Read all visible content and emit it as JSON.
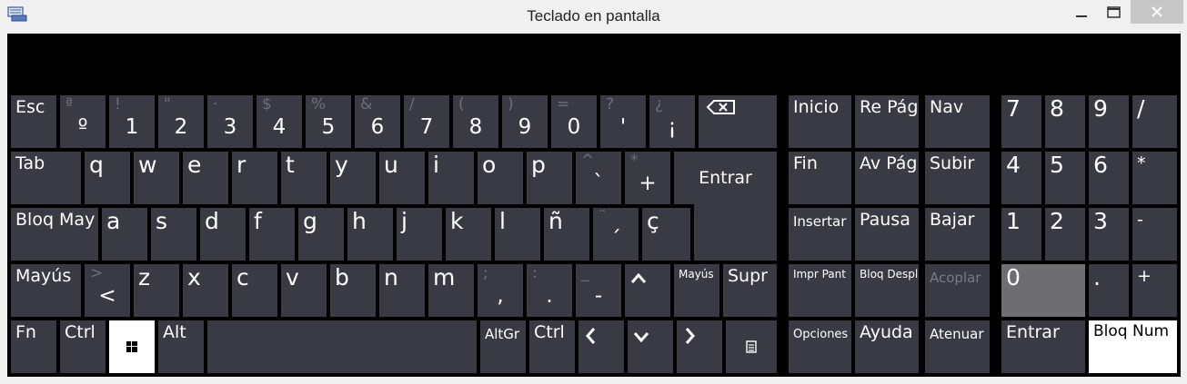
{
  "window": {
    "title": "Teclado en pantalla"
  },
  "row1": {
    "esc": "Esc",
    "k1": {
      "shift": "ª",
      "base": "º"
    },
    "k2": {
      "shift": "!",
      "base": "1"
    },
    "k3": {
      "shift": "\"",
      "base": "2"
    },
    "k4": {
      "shift": "·",
      "base": "3"
    },
    "k5": {
      "shift": "$",
      "base": "4"
    },
    "k6": {
      "shift": "%",
      "base": "5"
    },
    "k7": {
      "shift": "&",
      "base": "6"
    },
    "k8": {
      "shift": "/",
      "base": "7"
    },
    "k9": {
      "shift": "(",
      "base": "8"
    },
    "k10": {
      "shift": ")",
      "base": "9"
    },
    "k11": {
      "shift": "=",
      "base": "0"
    },
    "k12": {
      "shift": "?",
      "base": "'"
    },
    "k13": {
      "shift": "¿",
      "base": "¡"
    }
  },
  "row2": {
    "tab": "Tab",
    "letters": [
      "q",
      "w",
      "e",
      "r",
      "t",
      "y",
      "u",
      "i",
      "o",
      "p"
    ],
    "grave": {
      "shift": "^",
      "base": "`"
    },
    "plus": {
      "shift": "*",
      "base": "+"
    },
    "enter": "Entrar"
  },
  "row3": {
    "caps": "Bloq May",
    "letters": [
      "a",
      "s",
      "d",
      "f",
      "g",
      "h",
      "j",
      "k",
      "l",
      "ñ"
    ],
    "acute": {
      "shift": "¨",
      "base": "´"
    },
    "cedilla": "ç"
  },
  "row4": {
    "shift_left": "Mayús",
    "lt": {
      "shift": ">",
      "base": "<"
    },
    "letters": [
      "z",
      "x",
      "c",
      "v",
      "b",
      "n",
      "m"
    ],
    "comma": {
      "shift": ";",
      "base": ","
    },
    "period": {
      "shift": ":",
      "base": "."
    },
    "dash": {
      "shift": "_",
      "base": "-"
    },
    "up": "^",
    "shift_right": "Mayús",
    "del": "Supr"
  },
  "row5": {
    "fn": "Fn",
    "ctrl_left": "Ctrl",
    "alt": "Alt",
    "altgr": "AltGr",
    "ctrl_right": "Ctrl",
    "left": "<",
    "down": "v",
    "right": ">"
  },
  "nav": {
    "home": "Inicio",
    "pgup": "Re Pág",
    "navkey": "Nav",
    "end": "Fin",
    "pgdn": "Av Pág",
    "up": "Subir",
    "insert": "Insertar",
    "pause": "Pausa",
    "down": "Bajar",
    "prtsc": "Impr Pant",
    "scroll": "Bloq Despl",
    "dock": "Acoplar",
    "options": "Opciones",
    "help": "Ayuda",
    "fade": "Atenuar"
  },
  "numpad": {
    "n7": "7",
    "n8": "8",
    "n9": "9",
    "div": "/",
    "n4": "4",
    "n5": "5",
    "n6": "6",
    "mul": "*",
    "n1": "1",
    "n2": "2",
    "n3": "3",
    "sub": "-",
    "n0": "0",
    "dot": ".",
    "add": "+",
    "enter": "Entrar",
    "numlock": "Bloq Num"
  },
  "colors": {
    "key": "#3a3a44",
    "active": "#ffffff",
    "pressed": "#6d6d72",
    "background": "#000000"
  }
}
